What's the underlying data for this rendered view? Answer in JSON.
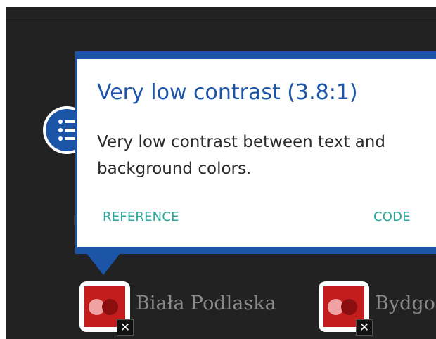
{
  "popup": {
    "title": "Very low contrast (3.8:1)",
    "body": "Very low contrast between text and background colors.",
    "links": {
      "reference": "REFERENCE",
      "code": "CODE"
    }
  },
  "list_button": {
    "icon": "list-icon"
  },
  "markers": [
    {
      "label": "Biała Podlaska",
      "close_symbol": "✕",
      "icon": "location-pin-icon"
    },
    {
      "label": "Bydgo",
      "close_symbol": "✕",
      "icon": "location-pin-icon"
    }
  ],
  "colors": {
    "accent": "#1c55a8",
    "link": "#2aa79b",
    "page_background": "#222222",
    "marker_red": "#c31d1d"
  }
}
